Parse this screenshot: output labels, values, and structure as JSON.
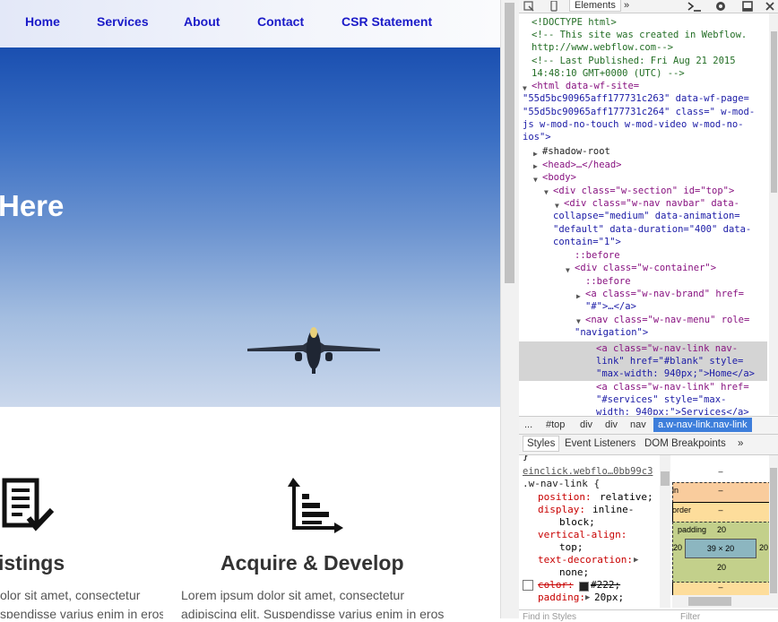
{
  "site": {
    "nav": {
      "home": "Home",
      "services": "Services",
      "about": "About",
      "contact": "Contact",
      "csr": "CSR Statement"
    },
    "hero_title": "Here",
    "feature1": {
      "title": "istings",
      "line1": "olor  sit  amet,  consectetur",
      "line2": "spendisse varius enim in eros"
    },
    "feature2": {
      "title": "Acquire & Develop",
      "line1": "Lorem  ipsum  dolor  sit  amet,  consectetur",
      "line2": "adipiscing elit. Suspendisse varius enim in eros"
    }
  },
  "devtools": {
    "tabs": {
      "elements": "Elements",
      "more": "»"
    },
    "dom": [
      "<!DOCTYPE html>",
      "<!-- This site was created in Webflow.",
      "http://www.webflow.com-->",
      "<!-- Last Published: Fri Aug 21 2015",
      "14:48:10 GMT+0000 (UTC) -->",
      "<html data-wf-site=",
      "\"55d5bc90965aff177731c263\" data-wf-page=",
      "\"55d5bc90965aff177731c264\" class=\" w-mod-",
      "js w-mod-no-touch w-mod-video w-mod-no-",
      "ios\">",
      "#shadow-root",
      "<head>…</head>",
      "<body>",
      "<div class=\"w-section\" id=\"top\">",
      "<div class=\"w-nav navbar\" data-",
      "collapse=\"medium\" data-animation=",
      "\"default\" data-duration=\"400\" data-",
      "contain=\"1\">",
      "::before",
      "<div class=\"w-container\">",
      "::before",
      "<a class=\"w-nav-brand\" href=",
      "\"#\">…</a>",
      "<nav class=\"w-nav-menu\" role=",
      "\"navigation\">",
      "<a class=\"w-nav-link nav-",
      "link\" href=\"#blank\" style=",
      "\"max-width: 940px;\">Home</a>",
      "<a class=\"w-nav-link\" href=",
      "\"#services\" style=\"max-",
      "width: 940px;\">Services</a>"
    ],
    "breadcrumb": {
      "dots": "...",
      "top": "#top",
      "div1": "div",
      "div2": "div",
      "nav": "nav",
      "active": "a.w-nav-link.nav-link"
    },
    "styles_tabs": {
      "styles": "Styles",
      "listeners": "Event Listeners",
      "breakpoints": "DOM Breakpoints",
      "more": "»"
    },
    "css": {
      "brace": "}",
      "source": "einclick.webflo…0bb99c3",
      "selector": ".w-nav-link {",
      "p1n": "position:",
      "p1v": " relative;",
      "p2n": "display:",
      "p2v": " inline-",
      "p2v2": "block;",
      "p3n": "vertical-align:",
      "p3v": "top;",
      "p4n": "text-decoration:",
      "p4v": "none;",
      "p5n": "color:",
      "p5v": "#222;",
      "p6n": "padding:",
      "p6v": "20px;"
    },
    "metrics": {
      "dash1": "–",
      "margin": "in",
      "dash2": "–",
      "border": "order",
      "dash3": "–",
      "padding": "padding",
      "pad_top": "20",
      "pad_left": "20",
      "size": "39 × 20",
      "pad_right": "20",
      "pad_bottom": "20",
      "dash4": "–"
    },
    "filter": {
      "left": "Find in Styles",
      "right": "Filter"
    }
  },
  "colors": {
    "nav_link": "#1a1ac8",
    "dom_tag": "#881280",
    "dom_attr": "#994500",
    "dom_val": "#1a1aa6",
    "dom_comment": "#236e25",
    "crumb_active": "#3d7edb",
    "padding_box": "#c3d08b",
    "margin_box": "#f9cc9d",
    "border_box": "#fddd9b",
    "content_box": "#8cb6c0"
  }
}
